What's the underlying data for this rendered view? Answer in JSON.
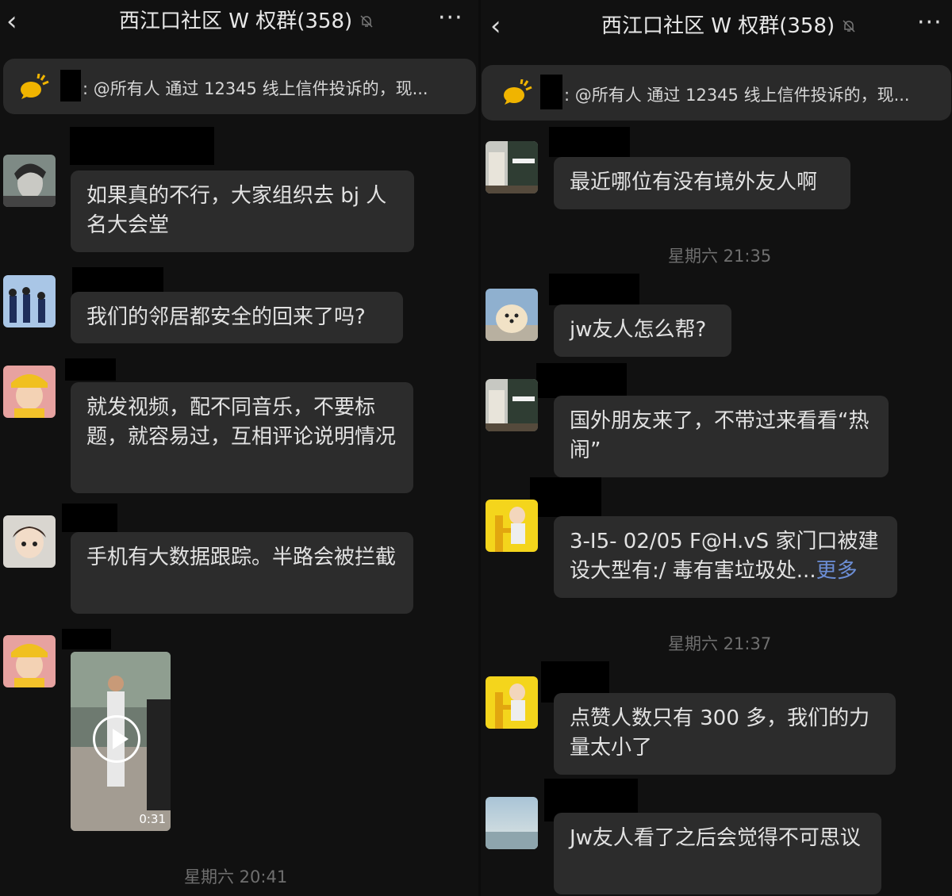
{
  "left": {
    "header": {
      "back_icon": "chevron-left-icon",
      "title": "西江口社区 W 权群(358)",
      "mute_icon": "bell-off-icon",
      "more_label": "···"
    },
    "notice": {
      "icon": "speaker-icon",
      "text": ": @所有人 通过 12345 线上信件投诉的，现..."
    },
    "messages": [
      {
        "avatar": "avatar-face-bw",
        "text": "如果真的不行，大家组织去 bj 人名大会堂"
      },
      {
        "avatar": "avatar-kids-dancing",
        "text": "我们的邻居都安全的回来了吗?"
      },
      {
        "avatar": "avatar-child-yellow-hat",
        "text": "就发视频，配不同音乐，不要标题，就容易过，互相评论说明情况"
      },
      {
        "avatar": "avatar-girl-cartoon",
        "text": "手机有大数据跟踪。半路会被拦截"
      },
      {
        "avatar": "avatar-child-yellow-hat",
        "video_duration": "0:31"
      }
    ],
    "timestamp": "星期六 20:41"
  },
  "right": {
    "header": {
      "back_icon": "chevron-left-icon",
      "title": "西江口社区 W 权群(358)",
      "mute_icon": "bell-off-icon",
      "more_label": "···"
    },
    "notice": {
      "icon": "speaker-icon",
      "text": ": @所有人 通过 12345 线上信件投诉的，现..."
    },
    "messages": [
      {
        "avatar": "avatar-street-building",
        "text": "最近哪位有没有境外友人啊"
      },
      {
        "avatar": "avatar-pomeranian",
        "text": "jw友人怎么帮?"
      },
      {
        "avatar": "avatar-street-building",
        "text": "国外朋友来了，不带过来看看“热闹”"
      },
      {
        "avatar": "avatar-baby-yellow",
        "text": "3-I5- 02/05 F@H.vS 家门口被建设大型有:/ 毒有害垃圾处...",
        "more_link": "更多"
      },
      {
        "avatar": "avatar-baby-yellow",
        "text": "点赞人数只有 300 多，我们的力量太小了"
      },
      {
        "avatar": "avatar-sea-sky",
        "text": "Jw友人看了之后会觉得不可思议"
      }
    ],
    "timestamps": [
      "星期六 21:35",
      "星期六 21:37"
    ]
  },
  "colors": {
    "background": "#111111",
    "bubble": "#2c2c2c",
    "notice": "#2a2a2a",
    "link": "#6c8ed6",
    "timestamp": "#6f6f6f"
  }
}
